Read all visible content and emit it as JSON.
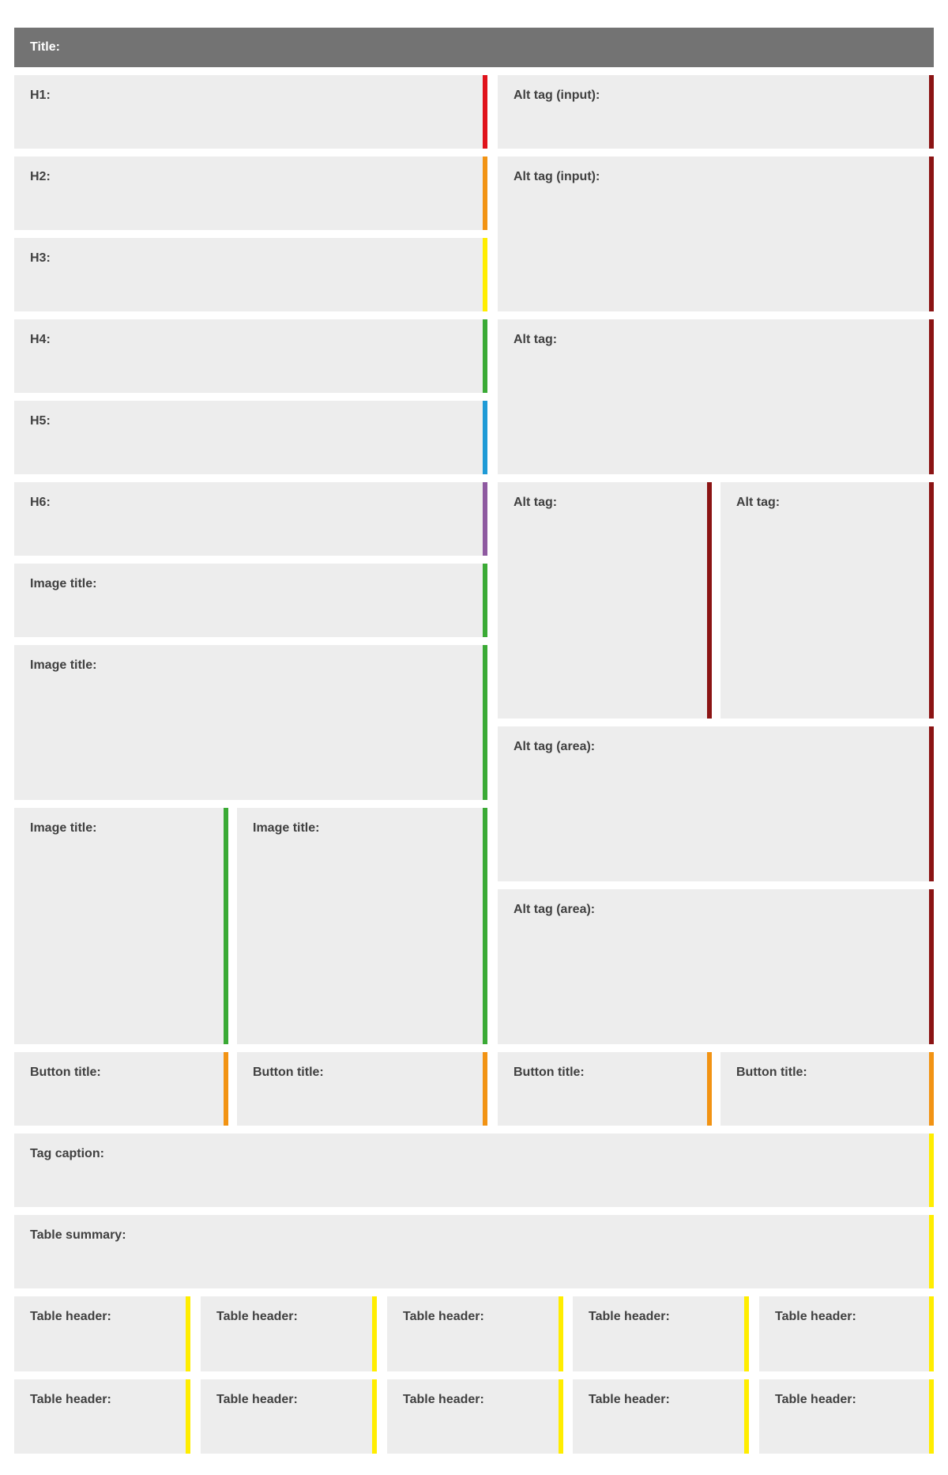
{
  "title_bar": {
    "label": "Title:"
  },
  "left_column": {
    "h1": "H1:",
    "h2": "H2:",
    "h3": "H3:",
    "h4": "H4:",
    "h5": "H5:",
    "h6": "H6:",
    "image_title_1": "Image title:",
    "image_title_2": "Image title:",
    "image_title_3": "Image title:",
    "image_title_4": "Image title:"
  },
  "right_column": {
    "alt_input_1": "Alt tag (input):",
    "alt_input_2": "Alt tag (input):",
    "alt_1": "Alt tag:",
    "alt_2": "Alt tag:",
    "alt_3": "Alt tag:",
    "alt_area_1": "Alt tag (area):",
    "alt_area_2": "Alt tag (area):"
  },
  "buttons": [
    "Button title:",
    "Button title:",
    "Button title:",
    "Button title:"
  ],
  "tag_caption": "Tag caption:",
  "table_summary": "Table summary:",
  "table_headers_row1": [
    "Table header:",
    "Table header:",
    "Table header:",
    "Table header:",
    "Table header:"
  ],
  "table_headers_row2": [
    "Table header:",
    "Table header:",
    "Table header:",
    "Table header:",
    "Table header:"
  ],
  "colors": {
    "title_bar": "#737373",
    "box_bg": "#ededed",
    "h1": "#e0121b",
    "h2": "#f29313",
    "h3": "#ffed00",
    "h4": "#3aaa35",
    "h5": "#1e9ad6",
    "h6": "#8e59a0",
    "image_title": "#3aaa35",
    "alt_tag": "#8b1414",
    "button": "#f29313",
    "caption_table": "#ffed00"
  }
}
